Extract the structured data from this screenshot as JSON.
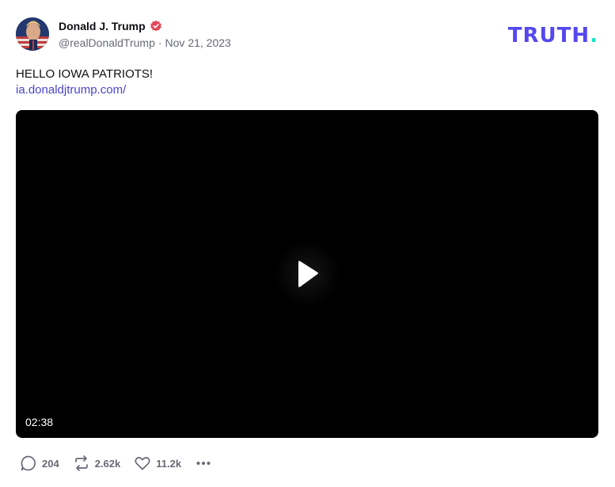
{
  "post": {
    "author": {
      "display_name": "Donald J. Trump",
      "handle": "@realDonaldTrump",
      "verified": true
    },
    "meta_separator": "·",
    "date": "Nov 21, 2023",
    "brand": {
      "text": "TRUTH",
      "dot": "."
    },
    "text": "HELLO IOWA PATRIOTS!",
    "link": "ia.donaldjtrump.com/",
    "video": {
      "duration": "02:38"
    },
    "actions": {
      "replies": "204",
      "retruths": "2.62k",
      "likes": "11.2k"
    }
  },
  "colors": {
    "brand": "#5448ee",
    "brand_dot": "#17e2c7",
    "link": "#4a45c9",
    "verified": "#e2485a",
    "muted": "#676a74"
  },
  "icons": [
    "verified-badge-icon",
    "play-icon",
    "reply-icon",
    "retruth-icon",
    "like-icon",
    "more-icon"
  ]
}
